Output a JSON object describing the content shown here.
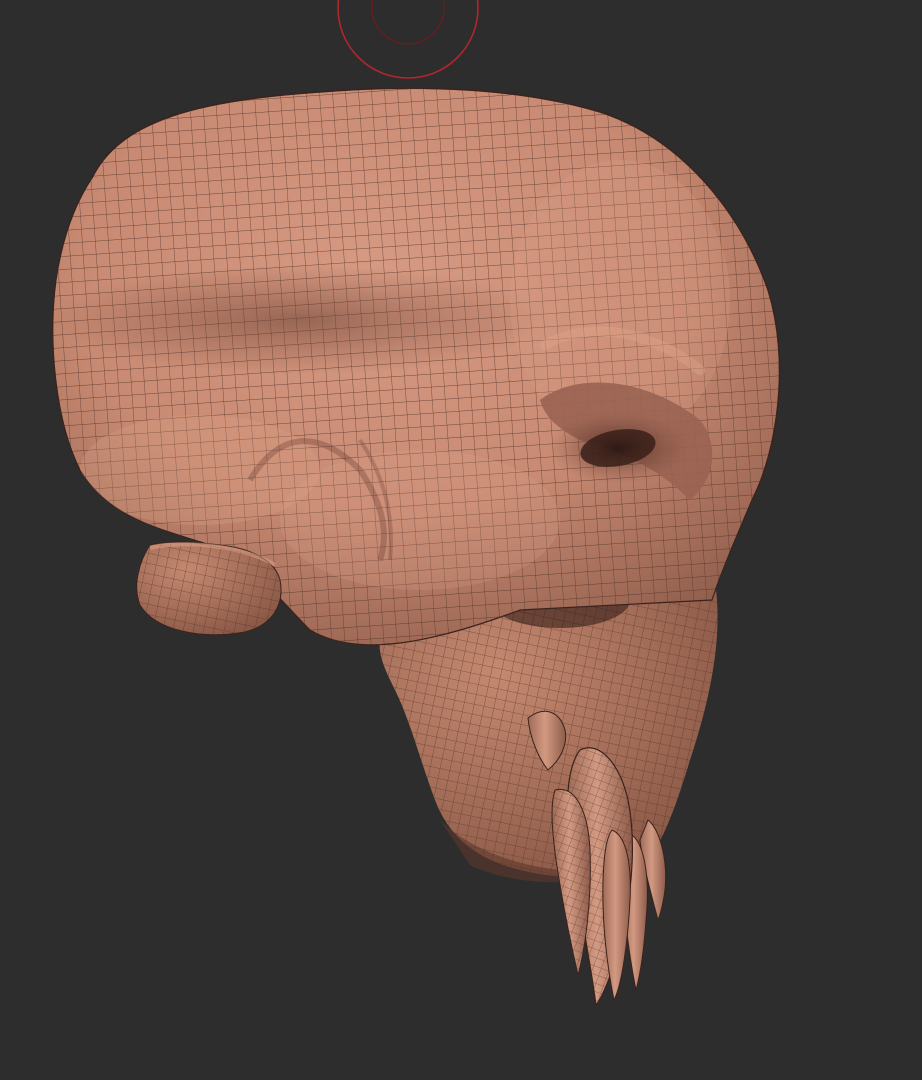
{
  "viewport": {
    "background_color": "#2d2d2d",
    "model": "skull-sculpt",
    "wireframe": true,
    "material_color": "#c88a72",
    "wire_color": "#4a2e27"
  },
  "brush_cursor": {
    "visible": true,
    "icon": "circle-brush-cursor",
    "color": "#b0272c"
  }
}
